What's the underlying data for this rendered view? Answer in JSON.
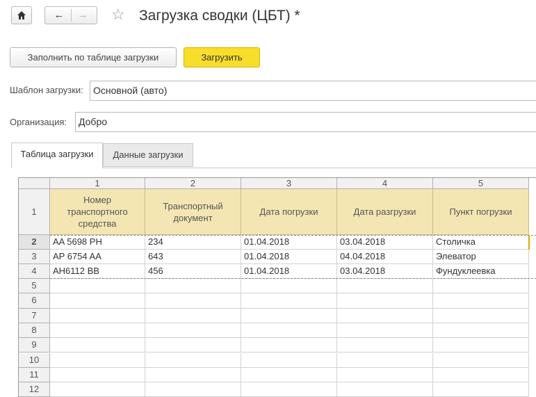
{
  "titlebar": {
    "home_icon": "home-icon",
    "back_icon": "arrow-left-icon",
    "forward_icon": "arrow-right-icon",
    "favorite_icon": "star-icon",
    "title": "Загрузка сводки (ЦБТ) *"
  },
  "toolbar": {
    "fill_button": "Заполнить по таблице загрузки",
    "load_button": "Загрузить",
    "load_button_color": "#f8dd2a"
  },
  "fields": {
    "template_label": "Шаблон загрузки:",
    "template_value": "Основной (авто)",
    "org_label": "Организация:",
    "org_value": "Добро"
  },
  "tabs": [
    {
      "label": "Таблица загрузки",
      "active": true
    },
    {
      "label": "Данные загрузки",
      "active": false
    }
  ],
  "grid": {
    "column_numbers": [
      "1",
      "2",
      "3",
      "4",
      "5"
    ],
    "header_row_number": "1",
    "headers": [
      "Номер транспортного средства",
      "Транспортный документ",
      "Дата погрузки",
      "Дата разгрузки",
      "Пункт погрузки"
    ],
    "rows": [
      {
        "num": "2",
        "cells": [
          "AA 5698 PH",
          "234",
          "01.04.2018",
          "03.04.2018",
          "Столичка"
        ]
      },
      {
        "num": "3",
        "cells": [
          "AP 6754 AA",
          "643",
          "01.04.2018",
          "04.04.2018",
          "Элеватор"
        ]
      },
      {
        "num": "4",
        "cells": [
          "AH6112 BB",
          "456",
          "01.04.2018",
          "03.04.2018",
          "Фундуклеевка"
        ]
      }
    ],
    "empty_rows": [
      "5",
      "6",
      "7",
      "8",
      "9",
      "10",
      "11",
      "12"
    ],
    "header_color": "#f3e6b3"
  }
}
